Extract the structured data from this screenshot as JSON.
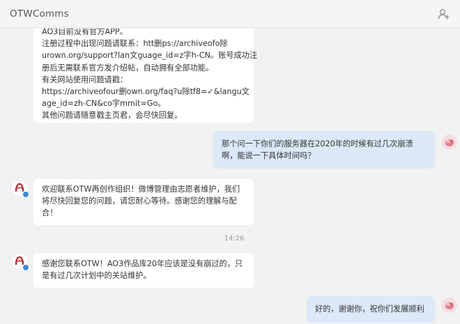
{
  "header": {
    "title": "OTWComms"
  },
  "messages": [
    {
      "sender": "OTWComms",
      "lines": [
        "AO3目前没有官方APP。",
        "注册过程中出现问题请联系：htt删ps://archiveofo除",
        "urown.org/support?lan文guage_id=z字h-CN。账号成功注",
        "册后无需联系官方发介绍帖，自动拥有全部功能。",
        "有关网站使用问题请戳：",
        "https://archiveofour删own.org/faq?u除tf8=✓&langu文",
        "age_id=zh-CN&co字mmit=Go。",
        "其他问题请随意戳主页君，会尽快回复。"
      ]
    },
    {
      "sender": "me",
      "lines": [
        "那个问一下你们的服务器在2020年的时候有过几次崩溃",
        "啊，能说一下具体时间吗？"
      ]
    },
    {
      "sender": "OTWComms",
      "lines": [
        "欢迎联系OTW再创作组织！微博管理由志愿者维护，我们",
        "将尽快回复您的问题，请您耐心等待。感谢您的理解与配",
        "合！"
      ]
    },
    {
      "sender": "OTWComms",
      "lines": [
        "感谢您联系OTW！AO3作品库20年应该是没有崩过的，只",
        "是有过几次计划中的关站维护。"
      ]
    },
    {
      "sender": "me",
      "lines": [
        "好的，谢谢你，祝你们发展顺利"
      ]
    }
  ],
  "timestamp": "14:26"
}
